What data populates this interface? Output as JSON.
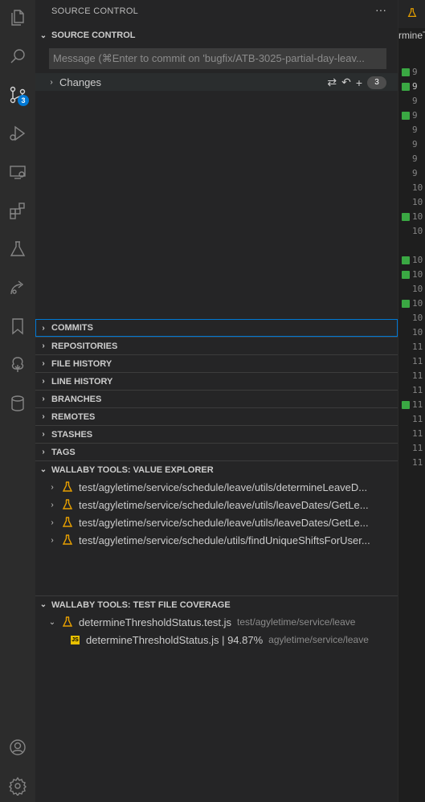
{
  "activity_bar": {
    "items": [
      "explorer-icon",
      "search-icon",
      "source-control-icon",
      "run-debug-icon",
      "remote-explorer-icon",
      "extensions-icon",
      "testing-icon",
      "live-share-icon",
      "bookmarks-icon",
      "tree-icon",
      "database-icon"
    ],
    "scm_badge": "3",
    "bottom": [
      "account-icon",
      "settings-gear-icon"
    ]
  },
  "sidebar": {
    "title": "SOURCE CONTROL",
    "more": "···",
    "scm_section": "SOURCE CONTROL",
    "commit_placeholder": "Message (⌘Enter to commit on 'bugfix/ATB-3025-partial-day-leav...",
    "changes_label": "Changes",
    "changes_count": "3",
    "sections": [
      "COMMITS",
      "REPOSITORIES",
      "FILE HISTORY",
      "LINE HISTORY",
      "BRANCHES",
      "REMOTES",
      "STASHES",
      "TAGS"
    ],
    "value_explorer": {
      "title": "WALLABY TOOLS: VALUE EXPLORER",
      "items": [
        "test/agyletime/service/schedule/leave/utils/determineLeaveD...",
        "test/agyletime/service/schedule/leave/utils/leaveDates/GetLe...",
        "test/agyletime/service/schedule/leave/utils/leaveDates/GetLe...",
        "test/agyletime/service/schedule/utils/findUniqueShiftsForUser..."
      ]
    },
    "coverage": {
      "title": "WALLABY TOOLS: TEST FILE COVERAGE",
      "test_file": "determineThresholdStatus.test.js",
      "test_path": "test/agyletime/service/leave",
      "source_file": "determineThresholdStatus.js | 94.87%",
      "source_path": "agyletime/service/leave",
      "js_label": "JS"
    }
  },
  "editor": {
    "tab_fragment": "rmineT",
    "lines": [
      "9",
      "9",
      "9",
      "9",
      "9",
      "9",
      "9",
      "9",
      "10",
      "10",
      "10",
      "10",
      "10",
      "10",
      "10",
      "10",
      "11",
      "11",
      "11",
      "11",
      "11",
      "11",
      "11",
      "11"
    ]
  },
  "colors": {
    "accent": "#0078d4",
    "coverage": "#3aa843",
    "flask": "#e8a000"
  }
}
